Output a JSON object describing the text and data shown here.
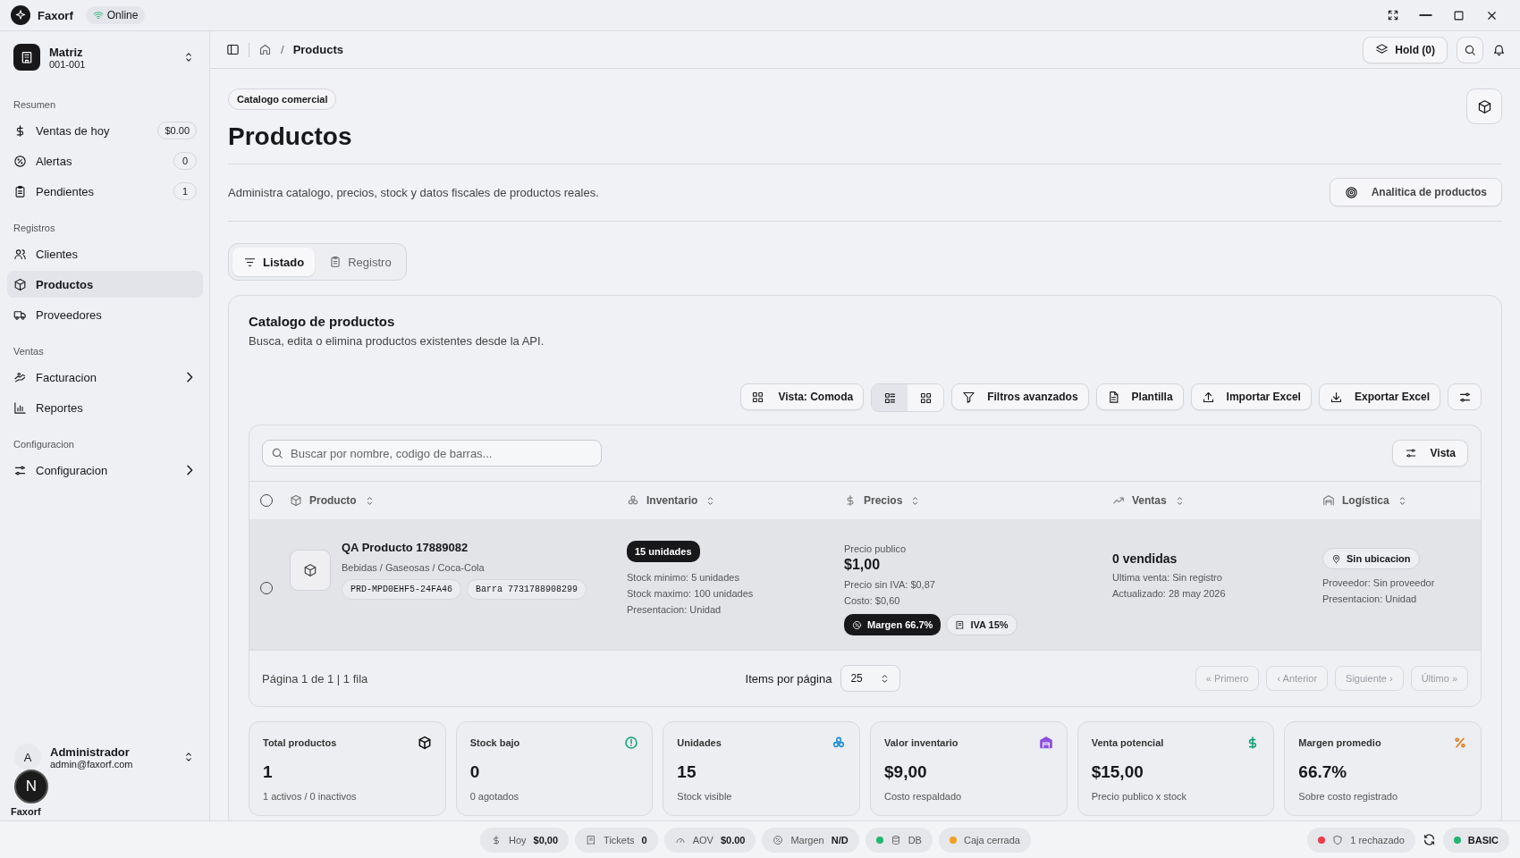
{
  "app": {
    "name": "Faxorf",
    "status": "Online"
  },
  "branch": {
    "name": "Matriz",
    "code": "001-001"
  },
  "sidebar": {
    "sections": [
      {
        "title": "Resumen",
        "items": [
          {
            "label": "Ventas de hoy",
            "kind": "link",
            "badge": "$0.00",
            "selected": false
          },
          {
            "label": "Alertas",
            "kind": "link",
            "badge": "0",
            "selected": false
          },
          {
            "label": "Pendientes",
            "kind": "link",
            "badge": "1",
            "selected": false
          }
        ]
      },
      {
        "title": "Registros",
        "items": [
          {
            "label": "Clientes",
            "kind": "link",
            "selected": false
          },
          {
            "label": "Productos",
            "kind": "link",
            "selected": true
          },
          {
            "label": "Proveedores",
            "kind": "link",
            "selected": false
          }
        ]
      },
      {
        "title": "Ventas",
        "items": [
          {
            "label": "Facturacion",
            "kind": "group",
            "selected": false
          },
          {
            "label": "Reportes",
            "kind": "link",
            "selected": false
          }
        ]
      },
      {
        "title": "Configuracion",
        "items": [
          {
            "label": "Configuracion",
            "kind": "group",
            "selected": false
          }
        ]
      }
    ]
  },
  "user": {
    "initial": "A",
    "name": "Administrador",
    "email": "admin@faxorf.com"
  },
  "footer": {
    "brand": "Faxorf",
    "dev_badge": "N"
  },
  "breadcrumb": {
    "separator": "/",
    "current": "Products"
  },
  "topbar": {
    "hold_button": "Hold (0)"
  },
  "page": {
    "tag": "Catalogo comercial",
    "title": "Productos",
    "description": "Administra catalogo, precios, stock y datos fiscales de productos reales.",
    "analytics_button": "Analitica de productos"
  },
  "tabs": [
    {
      "label": "Listado",
      "selected": true
    },
    {
      "label": "Registro",
      "selected": false
    }
  ],
  "catalog": {
    "title": "Catalogo de productos",
    "subtitle": "Busca, edita o elimina productos existentes desde la API.",
    "toolbar": {
      "density_button": "Vista: Comoda",
      "view_modes": [
        {
          "selected": true
        },
        {
          "selected": false
        }
      ],
      "buttons": [
        "Filtros avanzados",
        "Plantilla",
        "Importar Excel",
        "Exportar Excel"
      ]
    },
    "select_all": {
      "checked": false
    },
    "search": {
      "placeholder": "Buscar por nombre, codigo de barras..."
    },
    "view_button": "Vista",
    "columns": [
      "Producto",
      "Inventario",
      "Precios",
      "Ventas",
      "Logística"
    ],
    "rows": [
      {
        "checked": false,
        "name": "QA Producto 17889082",
        "category": "Bebidas / Gaseosas / Coca-Cola",
        "sku": "PRD-MPD0EHF5-24FA46",
        "barcode": "Barra 7731788908299",
        "stock_badge": "15 unidades",
        "stock_lines": [
          "Stock minimo: 5 unidades",
          "Stock maximo: 100 unidades",
          "Presentacion: Unidad"
        ],
        "price_label": "Precio publico",
        "price": "$1,00",
        "price_lines": [
          "Precio sin IVA: $0,87",
          "Costo: $0,60"
        ],
        "margin": "Margen 66.7%",
        "tax": "IVA 15%",
        "sales": "0 vendidas",
        "sales_lines": [
          "Ultima venta: Sin registro",
          "Actualizado: 28 may 2026"
        ],
        "location": "Sin ubicacion",
        "logistics_lines": [
          "Proveedor: Sin proveedor",
          "Presentacion: Unidad"
        ]
      }
    ],
    "pagination": {
      "summary": "Página 1 de 1 | 1 fila",
      "per_page_label": "Items por página",
      "per_page": "25",
      "buttons": [
        {
          "label": "« Primero",
          "disabled": true
        },
        {
          "label": "‹ Anterior",
          "disabled": true
        },
        {
          "label": "Siguiente ›",
          "disabled": true
        },
        {
          "label": "Último »",
          "disabled": true
        }
      ]
    }
  },
  "stats": [
    {
      "title": "Total productos",
      "value": "1",
      "note": "1 activos / 0 inactivos",
      "color": "#111111"
    },
    {
      "title": "Stock bajo",
      "value": "0",
      "note": "0 agotados",
      "color": "#16a37a"
    },
    {
      "title": "Unidades",
      "value": "15",
      "note": "Stock visible",
      "color": "#1d8fd6"
    },
    {
      "title": "Valor inventario",
      "value": "$9,00",
      "note": "Costo respaldado",
      "color": "#8b4fe0"
    },
    {
      "title": "Venta potencial",
      "value": "$15,00",
      "note": "Precio publico x stock",
      "color": "#16a37a"
    },
    {
      "title": "Margen promedio",
      "value": "66.7%",
      "note": "Sobre costo registrado",
      "color": "#e07a12"
    }
  ],
  "status_bar": {
    "items": [
      {
        "label": "Hoy",
        "value": "$0,00"
      },
      {
        "label": "Tickets",
        "value": "0"
      },
      {
        "label": "AOV",
        "value": "$0.00"
      },
      {
        "label": "Margen",
        "value": "N/D"
      },
      {
        "label": "DB",
        "color": "#22b573"
      },
      {
        "label": "Caja cerrada",
        "color": "#f0a020"
      }
    ],
    "right": {
      "rejected": {
        "label": "1 rechazado",
        "color": "#ee3b4b"
      },
      "plan": {
        "label": "BASIC",
        "color": "#22b573"
      }
    }
  }
}
